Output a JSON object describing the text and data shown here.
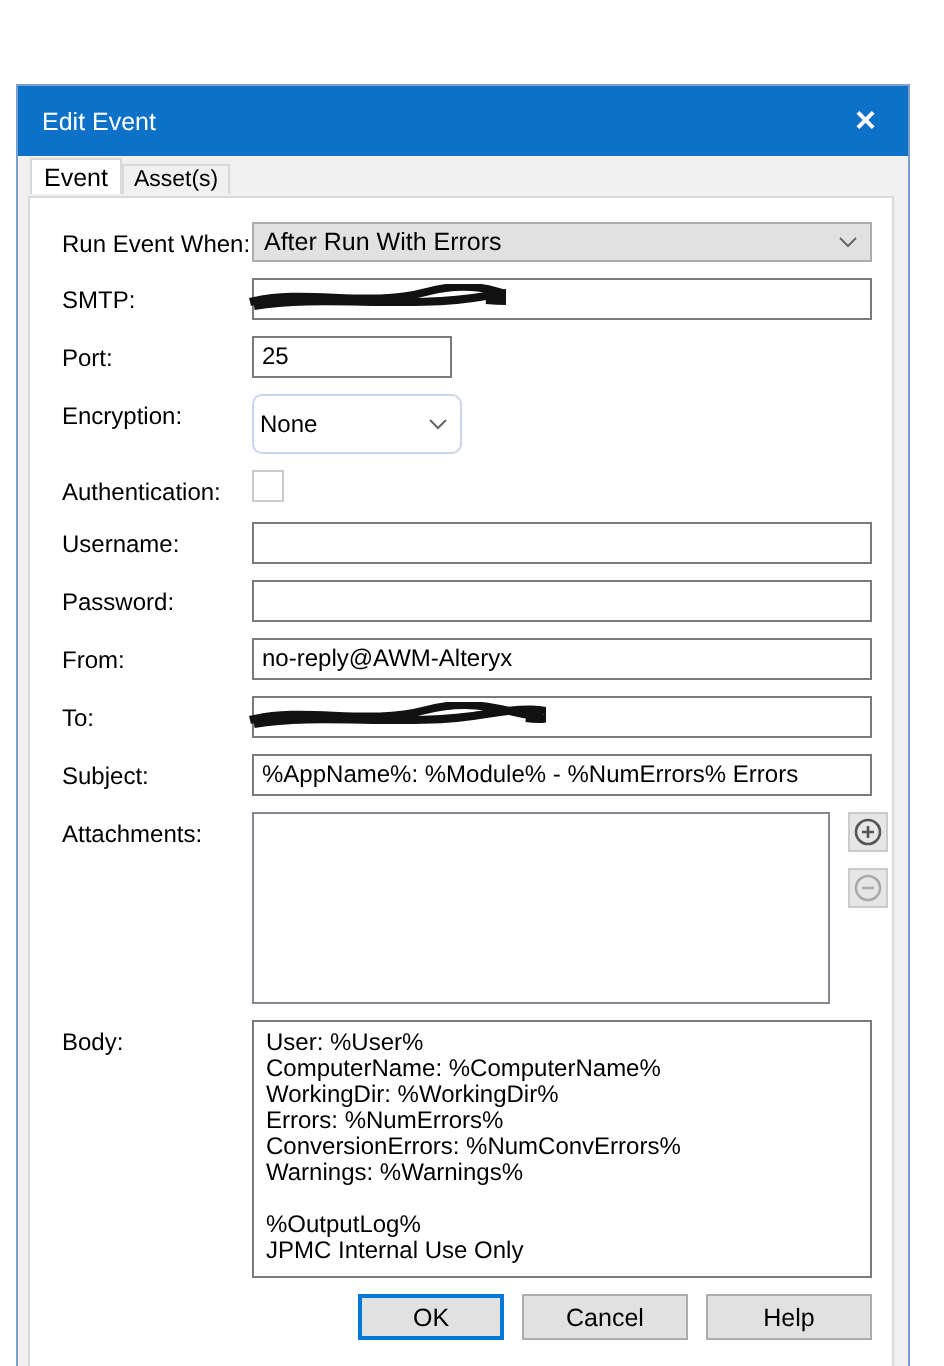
{
  "window": {
    "title": "Edit Event",
    "close": "×"
  },
  "tabs": [
    {
      "label": "Event",
      "selected": true
    },
    {
      "label": "Asset(s)",
      "selected": false
    }
  ],
  "fields": [
    {
      "kind": "select",
      "label": "Run Event When:",
      "value": "After Run With Errors"
    },
    {
      "kind": "text",
      "label": "SMTP:",
      "redacted": true
    },
    {
      "kind": "short",
      "label": "Port:",
      "value": "25"
    },
    {
      "kind": "dropdown",
      "label": "Encryption:",
      "value": "None"
    },
    {
      "kind": "checkbox",
      "label": "Authentication:",
      "checked": false
    },
    {
      "kind": "text",
      "label": "Username:"
    },
    {
      "kind": "text",
      "label": "Password:"
    },
    {
      "kind": "text",
      "label": "From:",
      "value": "no-reply@AWM-Alteryx"
    },
    {
      "kind": "text",
      "label": "To:",
      "redacted": true
    },
    {
      "kind": "text",
      "label": "Subject:",
      "value": "%AppName%: %Module% - %NumErrors% Errors"
    },
    {
      "kind": "list",
      "label": "Attachments:"
    },
    {
      "kind": "memo",
      "label": "Body:",
      "paragraphs": [
        [
          "User: %User%",
          "ComputerName: %ComputerName%",
          "WorkingDir: %WorkingDir%",
          "Errors: %NumErrors%",
          "ConversionErrors: %NumConvErrors%",
          "Warnings: %Warnings%"
        ],
        [
          "%OutputLog%",
          "JPMC Internal Use Only"
        ]
      ]
    }
  ],
  "buttons": [
    {
      "label": "OK",
      "default": true
    },
    {
      "label": "Cancel",
      "default": false
    },
    {
      "label": "Help",
      "default": false
    }
  ]
}
